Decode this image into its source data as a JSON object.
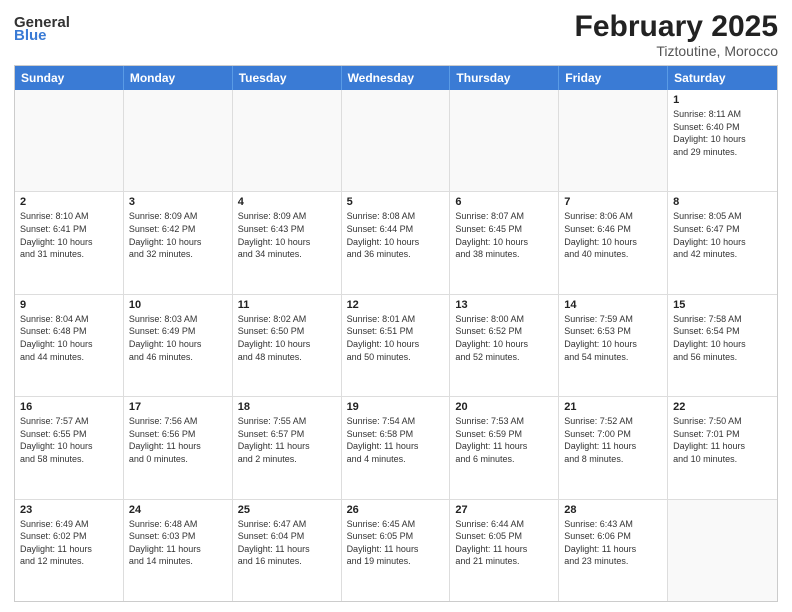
{
  "header": {
    "logo_general": "General",
    "logo_blue": "Blue",
    "title": "February 2025",
    "subtitle": "Tiztoutine, Morocco"
  },
  "days": [
    "Sunday",
    "Monday",
    "Tuesday",
    "Wednesday",
    "Thursday",
    "Friday",
    "Saturday"
  ],
  "rows": [
    [
      {
        "day": "",
        "empty": true
      },
      {
        "day": "",
        "empty": true
      },
      {
        "day": "",
        "empty": true
      },
      {
        "day": "",
        "empty": true
      },
      {
        "day": "",
        "empty": true
      },
      {
        "day": "",
        "empty": true
      },
      {
        "day": "1",
        "text": "Sunrise: 8:11 AM\nSunset: 6:40 PM\nDaylight: 10 hours\nand 29 minutes."
      }
    ],
    [
      {
        "day": "2",
        "text": "Sunrise: 8:10 AM\nSunset: 6:41 PM\nDaylight: 10 hours\nand 31 minutes."
      },
      {
        "day": "3",
        "text": "Sunrise: 8:09 AM\nSunset: 6:42 PM\nDaylight: 10 hours\nand 32 minutes."
      },
      {
        "day": "4",
        "text": "Sunrise: 8:09 AM\nSunset: 6:43 PM\nDaylight: 10 hours\nand 34 minutes."
      },
      {
        "day": "5",
        "text": "Sunrise: 8:08 AM\nSunset: 6:44 PM\nDaylight: 10 hours\nand 36 minutes."
      },
      {
        "day": "6",
        "text": "Sunrise: 8:07 AM\nSunset: 6:45 PM\nDaylight: 10 hours\nand 38 minutes."
      },
      {
        "day": "7",
        "text": "Sunrise: 8:06 AM\nSunset: 6:46 PM\nDaylight: 10 hours\nand 40 minutes."
      },
      {
        "day": "8",
        "text": "Sunrise: 8:05 AM\nSunset: 6:47 PM\nDaylight: 10 hours\nand 42 minutes."
      }
    ],
    [
      {
        "day": "9",
        "text": "Sunrise: 8:04 AM\nSunset: 6:48 PM\nDaylight: 10 hours\nand 44 minutes."
      },
      {
        "day": "10",
        "text": "Sunrise: 8:03 AM\nSunset: 6:49 PM\nDaylight: 10 hours\nand 46 minutes."
      },
      {
        "day": "11",
        "text": "Sunrise: 8:02 AM\nSunset: 6:50 PM\nDaylight: 10 hours\nand 48 minutes."
      },
      {
        "day": "12",
        "text": "Sunrise: 8:01 AM\nSunset: 6:51 PM\nDaylight: 10 hours\nand 50 minutes."
      },
      {
        "day": "13",
        "text": "Sunrise: 8:00 AM\nSunset: 6:52 PM\nDaylight: 10 hours\nand 52 minutes."
      },
      {
        "day": "14",
        "text": "Sunrise: 7:59 AM\nSunset: 6:53 PM\nDaylight: 10 hours\nand 54 minutes."
      },
      {
        "day": "15",
        "text": "Sunrise: 7:58 AM\nSunset: 6:54 PM\nDaylight: 10 hours\nand 56 minutes."
      }
    ],
    [
      {
        "day": "16",
        "text": "Sunrise: 7:57 AM\nSunset: 6:55 PM\nDaylight: 10 hours\nand 58 minutes."
      },
      {
        "day": "17",
        "text": "Sunrise: 7:56 AM\nSunset: 6:56 PM\nDaylight: 11 hours\nand 0 minutes."
      },
      {
        "day": "18",
        "text": "Sunrise: 7:55 AM\nSunset: 6:57 PM\nDaylight: 11 hours\nand 2 minutes."
      },
      {
        "day": "19",
        "text": "Sunrise: 7:54 AM\nSunset: 6:58 PM\nDaylight: 11 hours\nand 4 minutes."
      },
      {
        "day": "20",
        "text": "Sunrise: 7:53 AM\nSunset: 6:59 PM\nDaylight: 11 hours\nand 6 minutes."
      },
      {
        "day": "21",
        "text": "Sunrise: 7:52 AM\nSunset: 7:00 PM\nDaylight: 11 hours\nand 8 minutes."
      },
      {
        "day": "22",
        "text": "Sunrise: 7:50 AM\nSunset: 7:01 PM\nDaylight: 11 hours\nand 10 minutes."
      }
    ],
    [
      {
        "day": "23",
        "text": "Sunrise: 6:49 AM\nSunset: 6:02 PM\nDaylight: 11 hours\nand 12 minutes."
      },
      {
        "day": "24",
        "text": "Sunrise: 6:48 AM\nSunset: 6:03 PM\nDaylight: 11 hours\nand 14 minutes."
      },
      {
        "day": "25",
        "text": "Sunrise: 6:47 AM\nSunset: 6:04 PM\nDaylight: 11 hours\nand 16 minutes."
      },
      {
        "day": "26",
        "text": "Sunrise: 6:45 AM\nSunset: 6:05 PM\nDaylight: 11 hours\nand 19 minutes."
      },
      {
        "day": "27",
        "text": "Sunrise: 6:44 AM\nSunset: 6:05 PM\nDaylight: 11 hours\nand 21 minutes."
      },
      {
        "day": "28",
        "text": "Sunrise: 6:43 AM\nSunset: 6:06 PM\nDaylight: 11 hours\nand 23 minutes."
      },
      {
        "day": "",
        "empty": true
      }
    ]
  ]
}
